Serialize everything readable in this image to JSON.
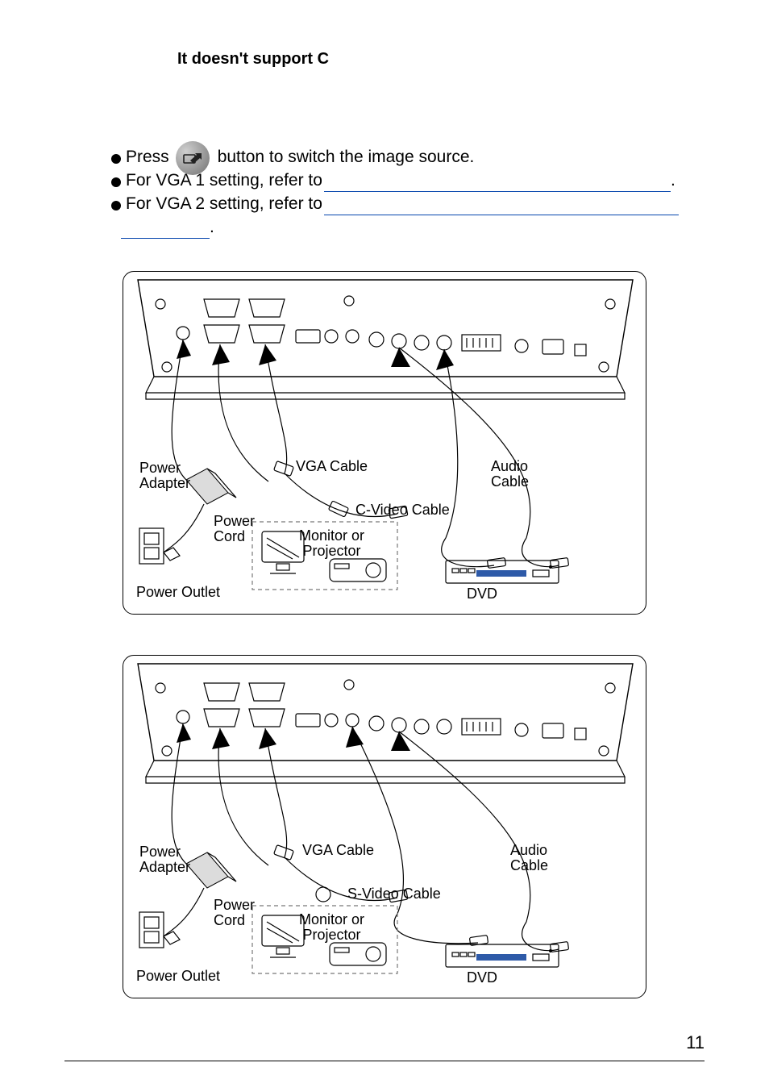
{
  "heading": "It doesn't support C",
  "bullet1": {
    "pre": "Press",
    "post": " button to switch the image source."
  },
  "bullet2": {
    "text": "For VGA 1 setting, refer to "
  },
  "bullet3": {
    "text": " For VGA 2 setting, refer to "
  },
  "period": ".",
  "diagram_labels": {
    "power_adapter": "Power\nAdapter",
    "power_cord": "Power\nCord",
    "power_outlet": "Power Outlet",
    "vga_cable": "VGA Cable",
    "c_video_cable": "C-Video Cable",
    "s_video_cable": "S-Video Cable",
    "audio_cable": "Audio\nCable",
    "monitor_or_projector": "Monitor or\nProjector",
    "dvd": "DVD"
  },
  "page_number": "11"
}
